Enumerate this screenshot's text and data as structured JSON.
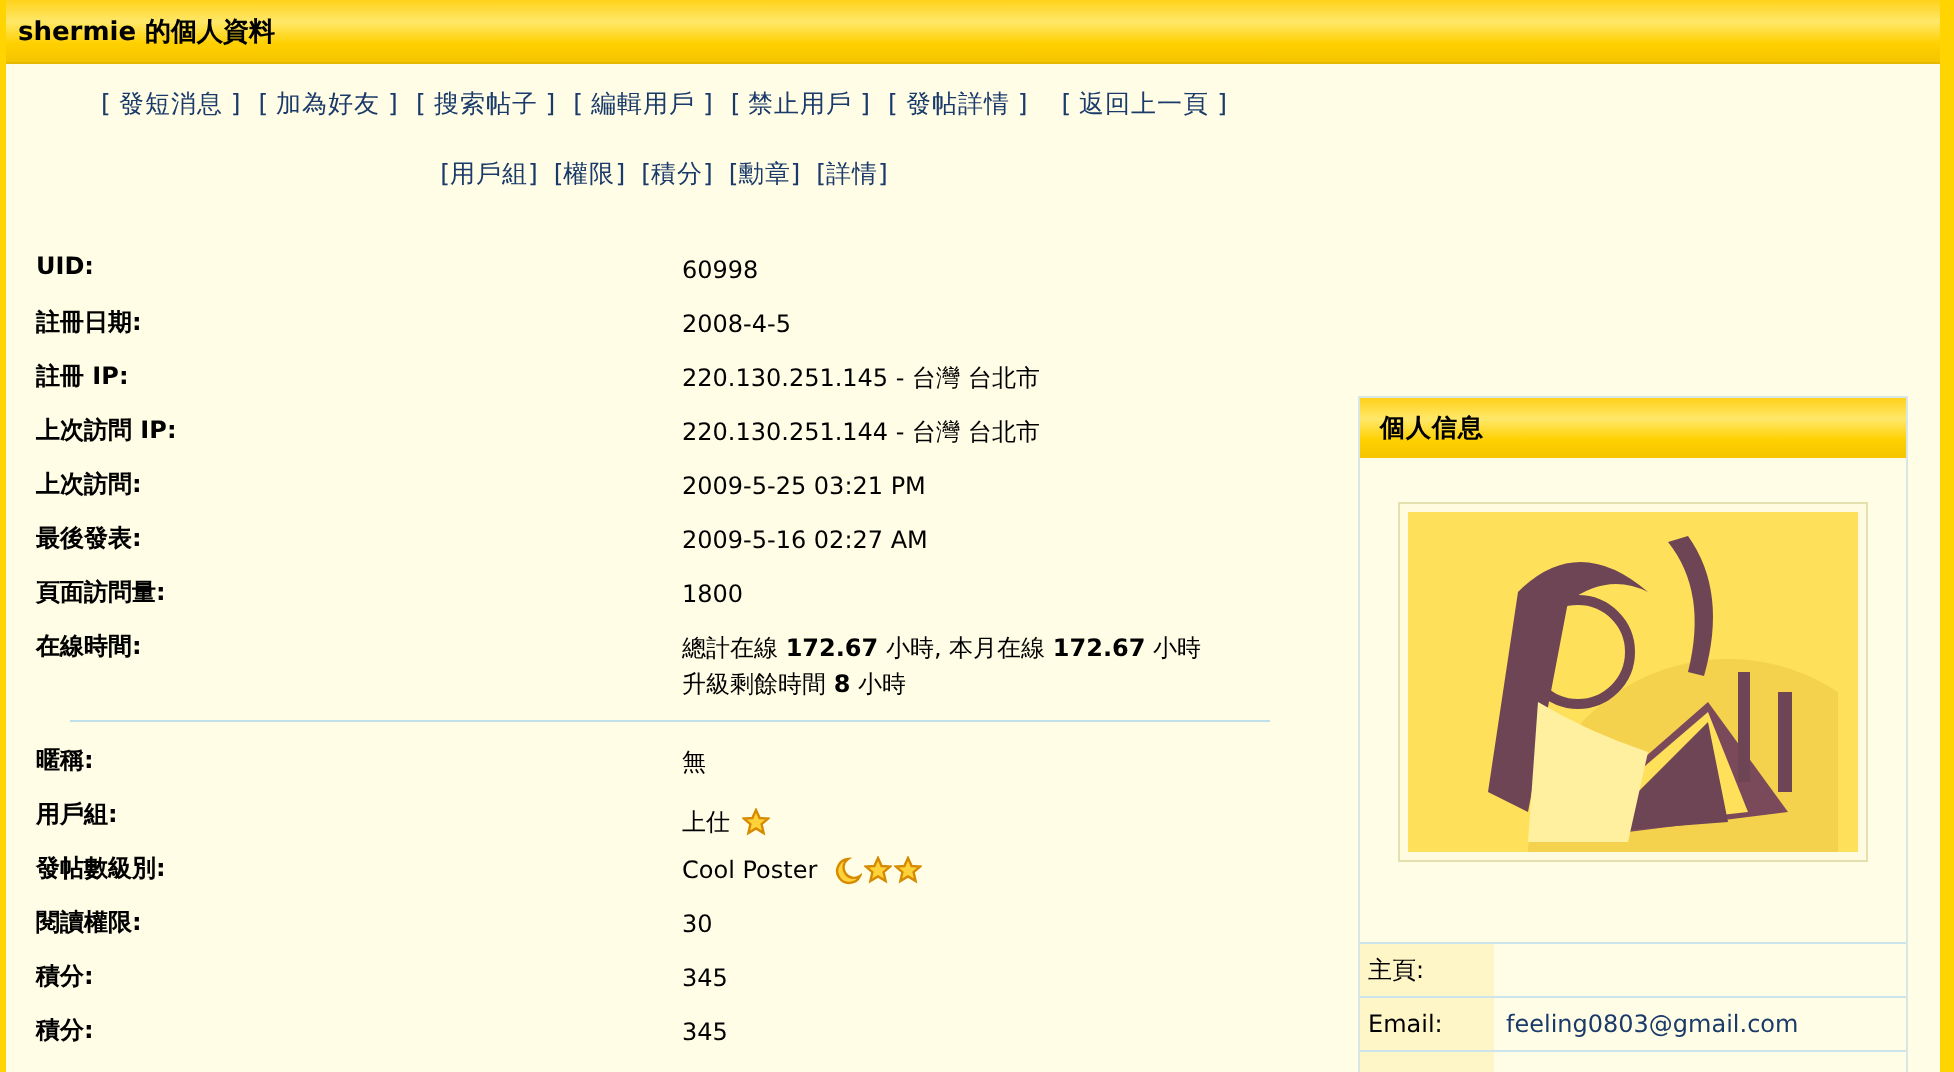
{
  "title": "shermie 的個人資料",
  "action_links": [
    "[ 發短消息 ]",
    "[ 加為好友 ]",
    "[ 搜索帖子 ]",
    "[ 編輯用戶 ]",
    "[ 禁止用戶 ]",
    "[ 發帖詳情 ]",
    "[ 返回上一頁 ]"
  ],
  "sub_links": [
    "[用戶組]",
    "[權限]",
    "[積分]",
    "[勳章]",
    "[詳情]"
  ],
  "info_rows": [
    {
      "label": "UID:",
      "lines": [
        "60998"
      ]
    },
    {
      "label": "註冊日期:",
      "lines": [
        "2008-4-5"
      ]
    },
    {
      "label": "註冊 IP:",
      "lines": [
        "220.130.251.145 - 台灣 台北市"
      ]
    },
    {
      "label": "上次訪問 IP:",
      "lines": [
        "220.130.251.144 - 台灣 台北市"
      ]
    },
    {
      "label": "上次訪問:",
      "lines": [
        "2009-5-25 03:21 PM"
      ]
    },
    {
      "label": "最後發表:",
      "lines": [
        "2009-5-16 02:27 AM"
      ]
    },
    {
      "label": "頁面訪問量:",
      "lines": [
        "1800"
      ]
    },
    {
      "label": "在線時間:",
      "lines": [
        "總計在線 **172.67** 小時, 本月在線 **172.67** 小時",
        "升級剩餘時間 **8** 小時"
      ]
    }
  ],
  "detail_rows": [
    {
      "label": "暱稱:",
      "lines": [
        "無"
      ]
    },
    {
      "label": "用戶組:",
      "lines": [
        "上仕"
      ],
      "icons": [
        {
          "kind": "star"
        }
      ]
    },
    {
      "label": "發帖數級別:",
      "lines": [
        "Cool Poster"
      ],
      "icons": [
        {
          "kind": "moon"
        },
        {
          "kind": "star"
        },
        {
          "kind": "star"
        }
      ]
    },
    {
      "label": "閱讀權限:",
      "lines": [
        "30"
      ]
    },
    {
      "label": "積分:",
      "lines": [
        "345"
      ]
    },
    {
      "label": "積分:",
      "lines": [
        "345"
      ]
    }
  ],
  "sidebar": {
    "title": "個人信息",
    "fields": [
      {
        "label": "主頁:"
      },
      {
        "label": "Email:",
        "value": "feeling0803@gmail.com"
      }
    ]
  }
}
